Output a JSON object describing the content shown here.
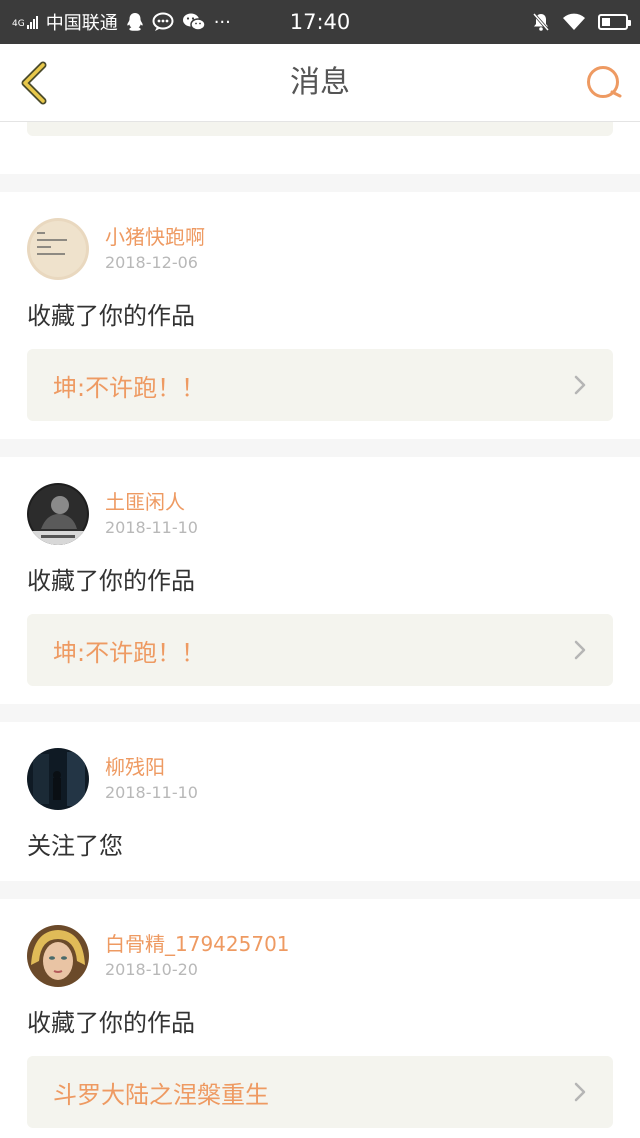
{
  "status_bar": {
    "network": "4G",
    "carrier": "中国联通",
    "more": "···",
    "time": "17:40"
  },
  "nav": {
    "title": "消息",
    "accent_color": "#ee9a62"
  },
  "messages": [
    {
      "username": "小猪快跑啊",
      "date": "2018-12-06",
      "action": "收藏了你的作品",
      "work": "坤:不许跑！！",
      "avatar": "avatar-paper-note"
    },
    {
      "username": "土匪闲人",
      "date": "2018-11-10",
      "action": "收藏了你的作品",
      "work": "坤:不许跑！！",
      "avatar": "avatar-bw-portrait"
    },
    {
      "username": "柳残阳",
      "date": "2018-11-10",
      "action": "关注了您",
      "work": null,
      "avatar": "avatar-dark-street"
    },
    {
      "username": "白骨精_179425701",
      "date": "2018-10-20",
      "action": "收藏了你的作品",
      "work": "斗罗大陆之涅槃重生",
      "avatar": "avatar-blonde-character"
    }
  ]
}
